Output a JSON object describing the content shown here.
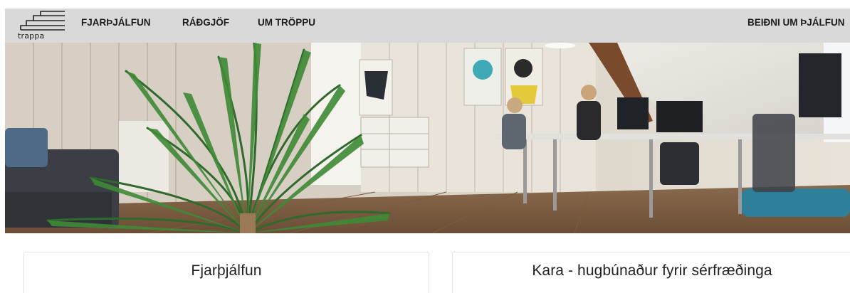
{
  "brand": {
    "logo_text": "trappa",
    "logo_icon": "stairs-logo-icon"
  },
  "nav": {
    "items": [
      {
        "label": "FJARÞJÁLFUN"
      },
      {
        "label": "RÁÐGJÖF"
      },
      {
        "label": "UM TRÖPPU"
      }
    ],
    "cta_label": "BEIÐNI UM ÞJÁLFUN"
  },
  "hero": {
    "image": "office-photo-with-plant"
  },
  "cards": [
    {
      "title": "Fjarþjálfun"
    },
    {
      "title": "Kara - hugbúnaður fyrir sérfræðinga"
    }
  ],
  "colors": {
    "navbar_bg": "#d8d9d8",
    "text": "#1c1c1c",
    "card_border": "#e3e3e3"
  }
}
